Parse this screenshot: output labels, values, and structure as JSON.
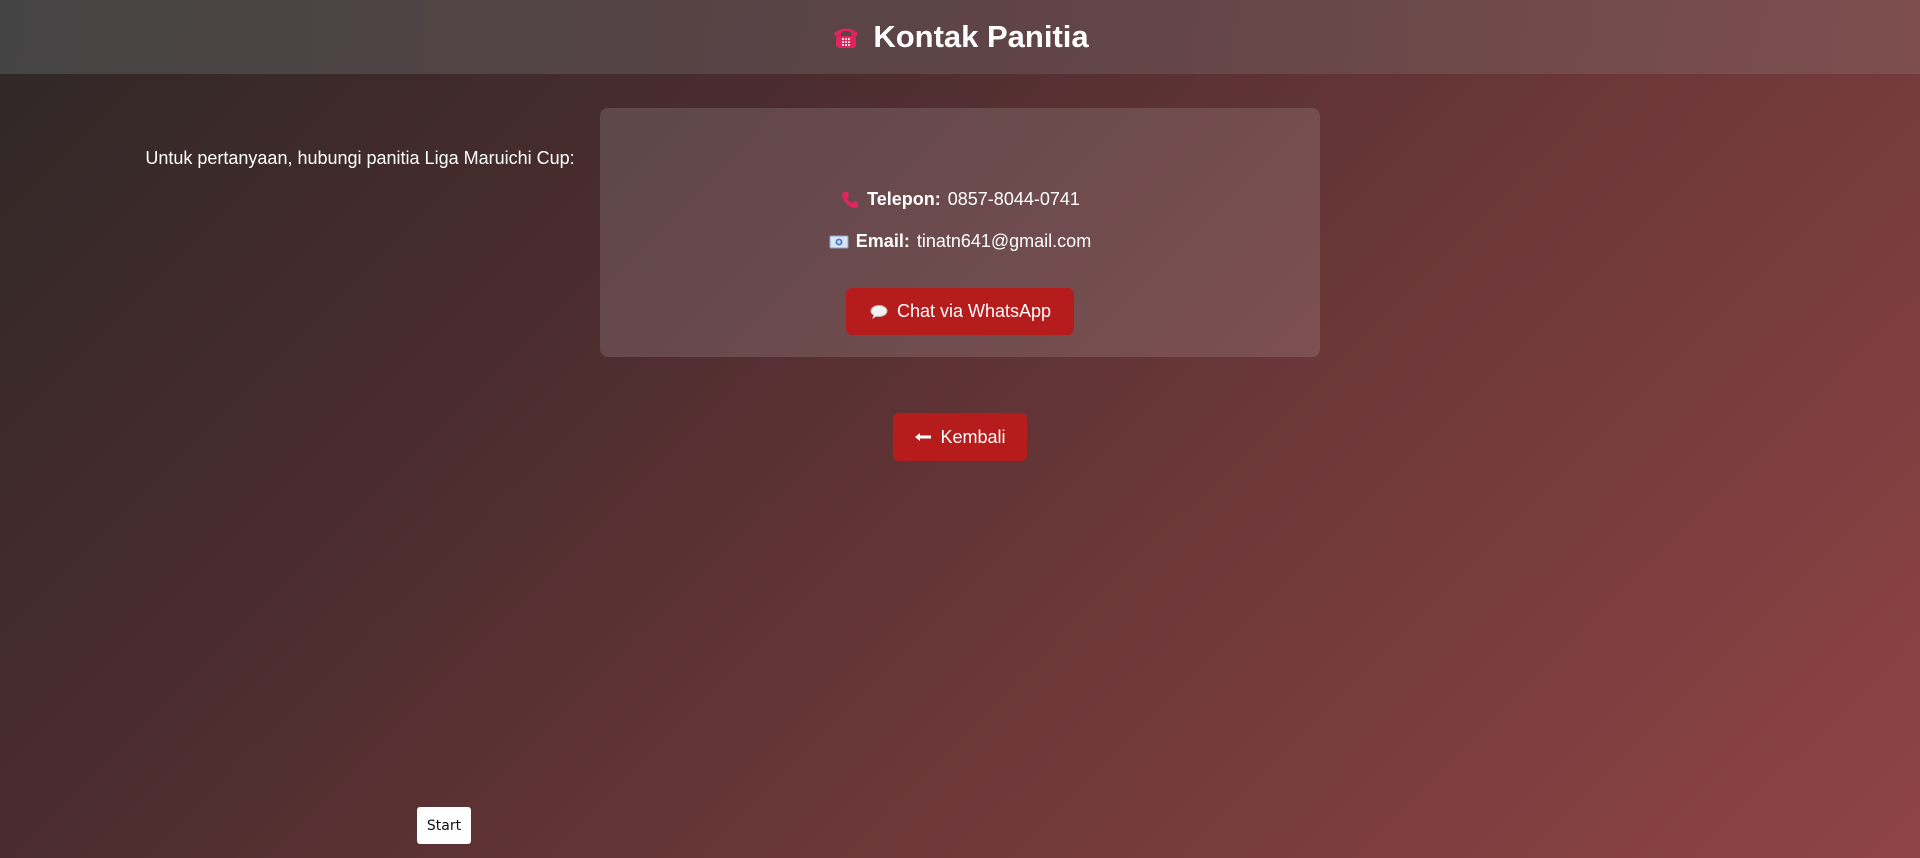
{
  "header": {
    "title": "Kontak Panitia",
    "icon": "telephone-icon"
  },
  "card": {
    "intro": "Untuk pertanyaan, hubungi panitia Liga Maruichi Cup:",
    "phone_label": "Telepon:",
    "phone_value": "0857-8044-0741",
    "phone_icon": "phone-receiver-icon",
    "email_label": "Email:",
    "email_value": "tinatn641@gmail.com",
    "email_icon": "email-icon",
    "whatsapp_button": "Chat via WhatsApp",
    "whatsapp_icon": "speech-bubble-icon"
  },
  "back_button": {
    "label": "Kembali",
    "icon": "left-arrow-icon"
  },
  "taskbar": {
    "start_label": "Start"
  },
  "colors": {
    "button_red": "#b71c1c",
    "accent_pink": "#e0245e"
  }
}
